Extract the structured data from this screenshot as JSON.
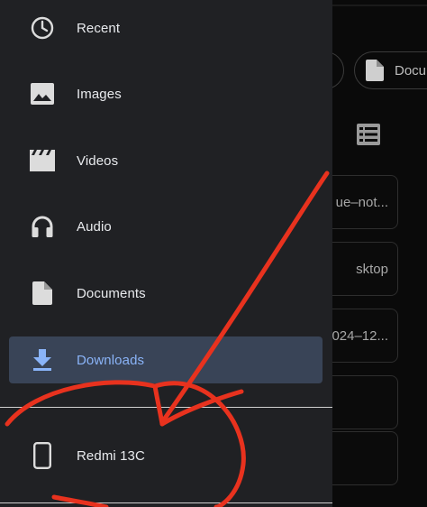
{
  "drawer": {
    "items": [
      {
        "label": "Recent",
        "icon": "clock-icon"
      },
      {
        "label": "Images",
        "icon": "image-icon"
      },
      {
        "label": "Videos",
        "icon": "video-icon"
      },
      {
        "label": "Audio",
        "icon": "headphones-icon"
      },
      {
        "label": "Documents",
        "icon": "document-icon"
      },
      {
        "label": "Downloads",
        "icon": "download-icon",
        "active": true
      }
    ],
    "devices": [
      {
        "label": "Redmi 13C",
        "icon": "phone-icon"
      }
    ]
  },
  "background": {
    "chip_label": "Docu",
    "cards": [
      "ue–not...",
      "sktop",
      "024–12..."
    ]
  },
  "colors": {
    "drawer_bg": "#202124",
    "active_bg": "#394457",
    "active_text": "#8ab4f8",
    "annotation": "#e8321e"
  }
}
